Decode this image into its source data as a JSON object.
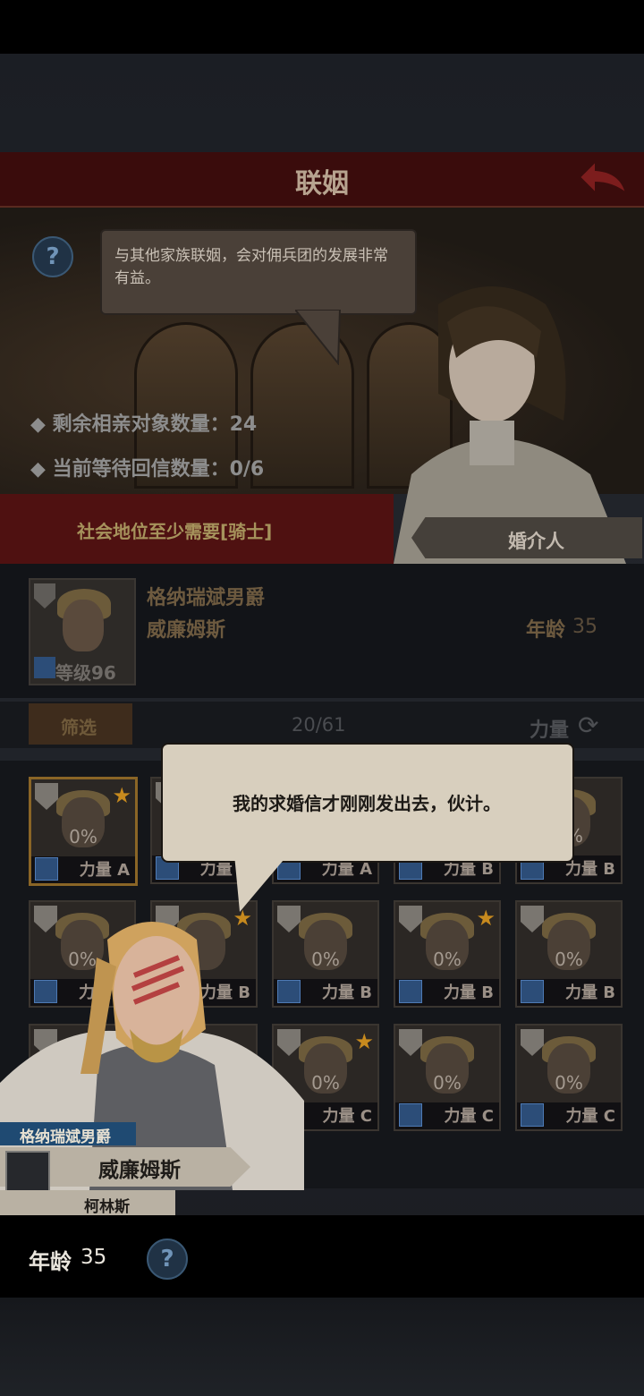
{
  "header": {
    "title": "联姻"
  },
  "intro": {
    "text": "与其他家族联姻，会对佣兵团的发展非常有益。"
  },
  "stats": [
    {
      "label": "◆ 剩余相亲对象数量：24"
    },
    {
      "label": "◆ 当前等待回信数量：0/6"
    }
  ],
  "requirement": {
    "text": "社会地位至少需要[骑士]"
  },
  "matchmaker": {
    "label": "婚介人"
  },
  "current_character": {
    "title": "格纳瑞斌男爵",
    "name": "威廉姆斯",
    "age_label": "年龄",
    "age": "35",
    "level_label": "等级96"
  },
  "filter": {
    "label": "筛选",
    "count": "20/61",
    "sort_label": "力量"
  },
  "cards": [
    {
      "pct": "0%",
      "stat": "力量 A",
      "star": true,
      "selected": true
    },
    {
      "pct": "",
      "stat": "力量 A",
      "star": false,
      "selected": false
    },
    {
      "pct": "",
      "stat": "力量 A",
      "star": false,
      "selected": false
    },
    {
      "pct": "",
      "stat": "力量 B",
      "star": false,
      "selected": false
    },
    {
      "pct": "0%",
      "stat": "力量 B",
      "star": false,
      "selected": false
    },
    {
      "pct": "0%",
      "stat": "力量 B",
      "star": false,
      "selected": false
    },
    {
      "pct": "",
      "stat": "力量 B",
      "star": true,
      "selected": false
    },
    {
      "pct": "0%",
      "stat": "力量 B",
      "star": false,
      "selected": false
    },
    {
      "pct": "0%",
      "stat": "力量 B",
      "star": true,
      "selected": false
    },
    {
      "pct": "0%",
      "stat": "力量 B",
      "star": false,
      "selected": false
    },
    {
      "pct": "",
      "stat": "",
      "star": false,
      "selected": false
    },
    {
      "pct": "",
      "stat": "",
      "star": false,
      "selected": false
    },
    {
      "pct": "0%",
      "stat": "力量 C",
      "star": true,
      "selected": false
    },
    {
      "pct": "0%",
      "stat": "力量 C",
      "star": false,
      "selected": false
    },
    {
      "pct": "0%",
      "stat": "力量 C",
      "star": false,
      "selected": false
    }
  ],
  "dialogue": {
    "text": "我的求婚信才刚刚发出去，伙计。"
  },
  "speaker": {
    "title": "格纳瑞斌男爵",
    "name": "威廉姆斯",
    "subtitle": "柯林斯"
  },
  "footer": {
    "age_label": "年龄",
    "age": "35"
  },
  "icons": [
    "help-icon",
    "back-arrow-icon",
    "shield-icon",
    "sword-icon",
    "star-icon",
    "refresh-icon"
  ],
  "colors": {
    "title_bar": "#3a0c0c",
    "requirement_bar": "#4f1111",
    "help_blue": "#203245"
  }
}
